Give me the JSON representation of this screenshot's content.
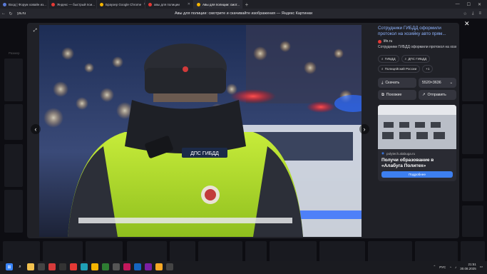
{
  "tabs": [
    {
      "label": "Вход | Форум ховайн из...",
      "color": "#5a7bd8"
    },
    {
      "label": "Яндекс — быстрый пои...",
      "color": "#e53935"
    },
    {
      "label": "Браузер Google Chrome",
      "color": "#f4b400"
    },
    {
      "label": "авы для полиции",
      "color": "#e53935"
    },
    {
      "label": "Авы для полиции: смот...",
      "color": "#f4b400"
    }
  ],
  "window_controls": {
    "minimize": "—",
    "maximize": "☐",
    "close": "✕"
  },
  "address": {
    "url": "ya.ru",
    "page_title": "Авы для полиции: смотрите и скачивайте изображения — Яндекс Картинки"
  },
  "viewer": {
    "title": "Сотрудники ГИБДД оформили протокол на хозяйку авто прям...",
    "source": "life.ru",
    "description": "Сотрудники ГИБДД оформили протокол на хозяйку авто прям...",
    "tags": [
      "ГИБДД",
      "ДПС ГИБДД",
      "Полицейский России",
      "+1"
    ],
    "download_label": "Скачать",
    "size_label": "5520×3636",
    "similar_label": "Похожие",
    "share_label": "Отправить",
    "vest_text": "ДПС ГИБДД",
    "close_glyph": "✕",
    "prev_glyph": "‹",
    "next_glyph": "›"
  },
  "ad": {
    "domain": "polytech.alabuga.ru",
    "title": "Получи образование в «Алабуга Политех»",
    "button": "Подробнее"
  },
  "background": {
    "filter_label": "Размер"
  },
  "taskbar": {
    "lang": "РУС",
    "time": "21:51",
    "date": "30.08.2025"
  },
  "colors": {
    "accent_blue": "#3d7ff0",
    "vest": "#b6e02a",
    "police_red": "#ff2b2b"
  }
}
